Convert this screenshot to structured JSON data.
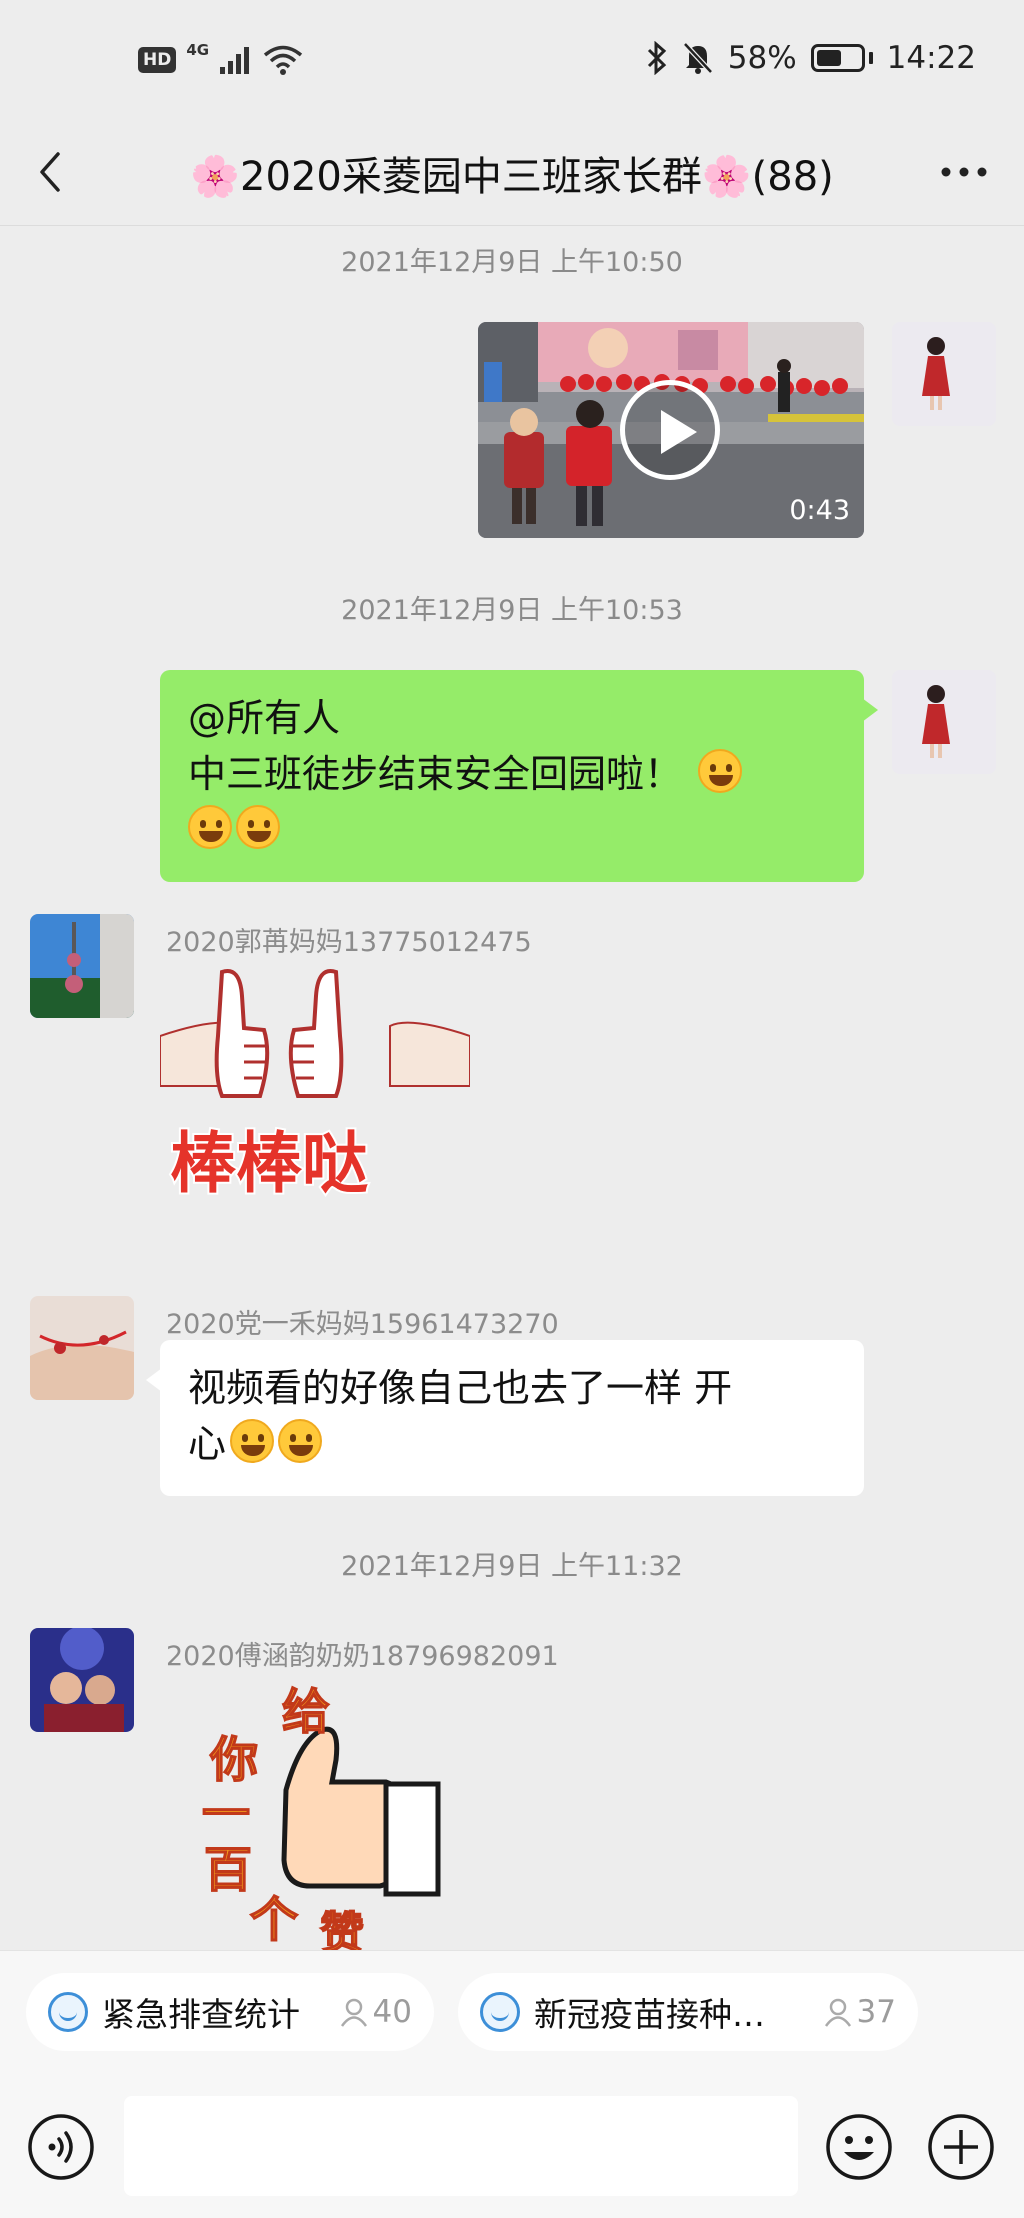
{
  "status": {
    "hd": "HD",
    "network": "4G",
    "battery": "58%",
    "battery_level": 0.58,
    "time": "14:22"
  },
  "header": {
    "title": "🌸2020采菱园中三班家长群🌸(88)"
  },
  "messages": {
    "t1": "2021年12月9日 上午10:50",
    "video_duration": "0:43",
    "t2": "2021年12月9日 上午10:53",
    "green_line1": "@所有人",
    "green_line2": "中三班徒步结束安全回园啦！",
    "nick1": "2020郭苒妈妈13775012475",
    "sticker1_text": "棒棒哒",
    "nick2": "2020党一禾妈妈15961473270",
    "white_line1": "视频看的好像自己也去了一样 开",
    "white_line2": "心",
    "t3": "2021年12月9日 上午11:32",
    "nick3": "2020傅涵韵奶奶18796982091",
    "sticker2_chars": [
      "给",
      "你",
      "一",
      "百",
      "个",
      "赞"
    ]
  },
  "shortcuts": [
    {
      "label": "紧急排查统计",
      "count": "40"
    },
    {
      "label": "新冠疫苗接种…",
      "count": "37"
    }
  ],
  "colors": {
    "chat_bg": "#ededed",
    "green_bubble": "#95ec69",
    "time_text": "#8a8a8a"
  },
  "icons": [
    "back-arrow-icon",
    "more-dots-icon",
    "voice-icon",
    "emoji-icon",
    "plus-icon",
    "play-icon",
    "person-icon",
    "bluetooth-icon",
    "mute-bell-icon",
    "wifi-icon",
    "signal-icon"
  ]
}
